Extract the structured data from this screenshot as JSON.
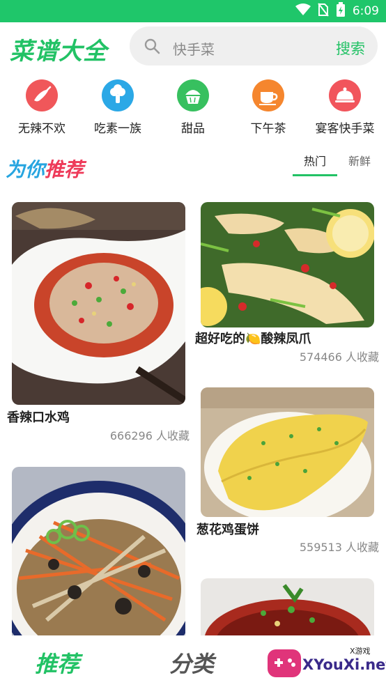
{
  "status_bar": {
    "time": "6:09",
    "icons": [
      "wifi-icon",
      "no-sim-icon",
      "battery-charging-icon"
    ]
  },
  "header": {
    "logo": "菜谱大全",
    "search_placeholder": "快手菜",
    "search_button": "搜索"
  },
  "categories": [
    {
      "label": "无辣不欢",
      "icon": "chili-icon",
      "color": "#f0575a"
    },
    {
      "label": "吃素一族",
      "icon": "vegetable-icon",
      "color": "#2ba8e6"
    },
    {
      "label": "甜品",
      "icon": "cake-icon",
      "color": "#37c05f"
    },
    {
      "label": "下午茶",
      "icon": "tea-cup-icon",
      "color": "#f5862e"
    },
    {
      "label": "宴客快手菜",
      "icon": "dish-cover-icon",
      "color": "#f1555c"
    }
  ],
  "recommend": {
    "title_part1": "为你",
    "title_part2": "推荐",
    "tabs": [
      "热门",
      "新鲜"
    ],
    "active_tab": "热门"
  },
  "recipes": [
    {
      "title": "香辣口水鸡",
      "count": "666296 人收藏"
    },
    {
      "title": "超好吃的🍋酸辣凤爪",
      "count": "574466 人收藏"
    },
    {
      "title": "葱花鸡蛋饼",
      "count": "559513 人收藏"
    }
  ],
  "bottom_nav": {
    "items": [
      "推荐",
      "分类"
    ],
    "active": "推荐"
  },
  "watermark": {
    "text": "XYouXi.net",
    "small": "X游戏"
  },
  "colors": {
    "brand_green": "#22c265",
    "status_bar": "#1fc66a",
    "accent_blue": "#27a5e0",
    "accent_red": "#ee3a59"
  }
}
